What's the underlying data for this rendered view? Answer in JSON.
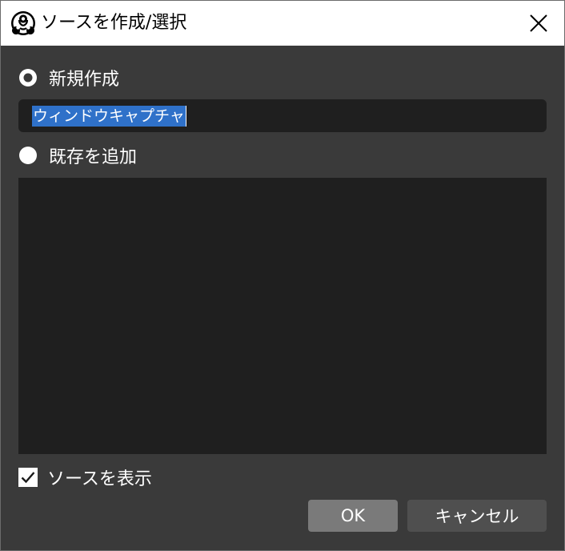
{
  "window": {
    "title": "ソースを作成/選択",
    "app_icon": "obs-logo-icon",
    "close_icon": "close-icon"
  },
  "new_source": {
    "label": "新規作成",
    "selected": true,
    "name_value": "ウィンドウキャプチャ"
  },
  "existing_source": {
    "label": "既存を追加",
    "selected": false,
    "items": []
  },
  "visible_option": {
    "label": "ソースを表示",
    "checked": true
  },
  "buttons": {
    "ok": "OK",
    "cancel": "キャンセル"
  },
  "colors": {
    "titlebar": "#ffffff",
    "background": "#3a3a3a",
    "field": "#1f1f1f",
    "selection": "#2f71c9",
    "ok_button": "#7a7a7a",
    "cancel_button": "#4f4f4f"
  }
}
